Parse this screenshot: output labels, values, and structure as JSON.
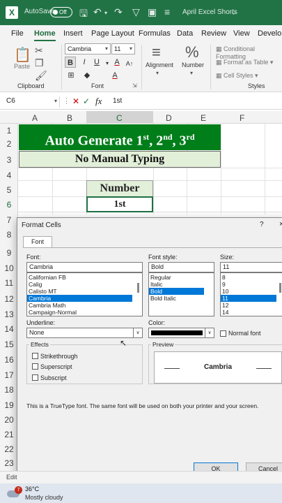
{
  "titlebar": {
    "autosave_label": "AutoSave",
    "autosave_state": "Off",
    "filename": "April Excel Shorts",
    "accent": "#217346"
  },
  "tabs": [
    "File",
    "Home",
    "Insert",
    "Page Layout",
    "Formulas",
    "Data",
    "Review",
    "View",
    "Develop"
  ],
  "active_tab": "Home",
  "ribbon": {
    "clipboard": {
      "label": "Clipboard",
      "paste_label": "Paste"
    },
    "font": {
      "label": "Font",
      "font_name": "Cambria",
      "font_size": "11"
    },
    "alignment_label": "Alignment",
    "number_label": "Number",
    "styles": {
      "label": "Styles",
      "conditional": "Conditional Formatting",
      "format_table": "Format as Table",
      "cell_styles": "Cell Styles"
    }
  },
  "formula_bar": {
    "name_box": "C6",
    "value": "1st"
  },
  "columns": [
    "A",
    "B",
    "C",
    "D",
    "E",
    "F"
  ],
  "selected_column": "C",
  "rows": [
    "1",
    "2",
    "3",
    "4",
    "5",
    "6",
    "7",
    "8",
    "9",
    "10",
    "11",
    "12",
    "13",
    "14",
    "15",
    "16",
    "17",
    "18",
    "19",
    "20",
    "21",
    "22",
    "23"
  ],
  "selected_row": "6",
  "sheet": {
    "title_main": "Auto Generate 1",
    "sup1": "st",
    "sep1": ", 2",
    "sup2": "nd",
    "sep2": ", 3",
    "sup3": "rd",
    "subtitle": "No Manual Typing",
    "number_header": "Number",
    "first_value": "1st",
    "title_fill": "#007e1a",
    "subtitle_fill": "#e2efd9"
  },
  "dialog": {
    "title": "Format Cells",
    "help": "?",
    "close": "×",
    "tab": "Font",
    "font_label": "Font:",
    "font_value": "Cambria",
    "font_list": [
      "Californian FB",
      "Calig",
      "Calisto MT",
      "Cambria",
      "Cambria Math",
      "Campaign-Normal"
    ],
    "font_selected": "Cambria",
    "style_label": "Font style:",
    "style_value": "Bold",
    "style_list": [
      "Regular",
      "Italic",
      "Bold",
      "Bold Italic"
    ],
    "style_selected": "Bold",
    "size_label": "Size:",
    "size_value": "11",
    "size_list": [
      "8",
      "9",
      "10",
      "11",
      "12",
      "14"
    ],
    "size_selected": "11",
    "underline_label": "Underline:",
    "underline_value": "None",
    "color_label": "Color:",
    "normal_font_label": "Normal font",
    "effects_label": "Effects",
    "strikethrough_label": "Strikethrough",
    "superscript_label": "Superscript",
    "subscript_label": "Subscript",
    "preview_label": "Preview",
    "preview_text": "Cambria",
    "note": "This is a TrueType font.  The same font will be used on both your printer and your screen.",
    "ok_label": "OK",
    "cancel_label": "Cancel"
  },
  "statusbar": {
    "mode": "Edit"
  },
  "taskbar": {
    "temperature": "36°C",
    "condition": "Mostly cloudy",
    "badge": "7"
  }
}
